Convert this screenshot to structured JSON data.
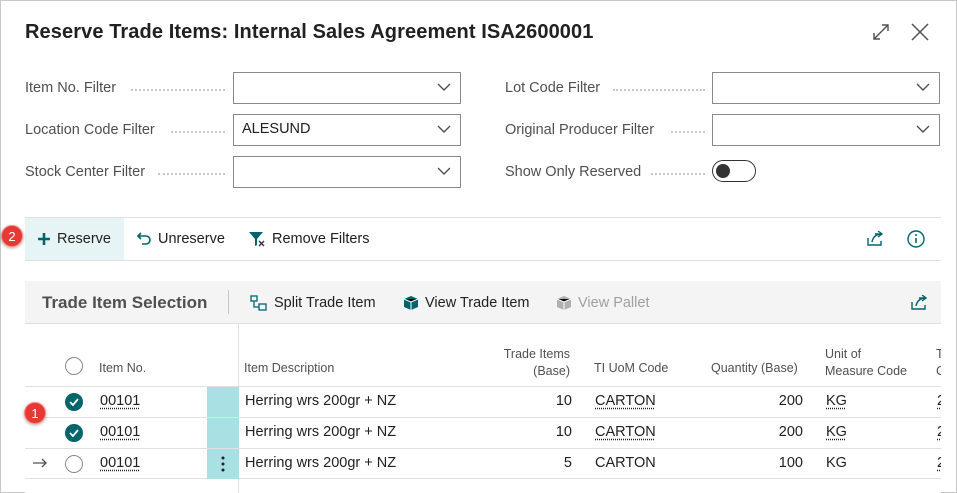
{
  "dialog": {
    "title": "Reserve Trade Items: Internal Sales Agreement ISA2600001",
    "expand_icon": "expand-icon",
    "close_icon": "close-icon"
  },
  "filters": {
    "item_no": {
      "label": "Item No. Filter",
      "value": ""
    },
    "location_code": {
      "label": "Location Code Filter",
      "value": "ALESUND"
    },
    "stock_center": {
      "label": "Stock Center Filter",
      "value": ""
    },
    "lot_code": {
      "label": "Lot Code Filter",
      "value": ""
    },
    "original_producer": {
      "label": "Original Producer Filter",
      "value": ""
    },
    "show_only_reserved": {
      "label": "Show Only Reserved",
      "value": false
    }
  },
  "actions": {
    "reserve": "Reserve",
    "unreserve": "Unreserve",
    "remove_filters": "Remove Filters",
    "share_icon": "share-icon",
    "info_icon": "info-icon"
  },
  "badges": {
    "one": "1",
    "two": "2"
  },
  "part": {
    "title": "Trade Item Selection",
    "actions": {
      "split": "Split Trade Item",
      "view_trade_item": "View Trade Item",
      "view_pallet": "View Pallet"
    },
    "columns": {
      "item_no": "Item No.",
      "item_description": "Item Description",
      "trade_items_l1": "Trade Items",
      "trade_items_l2": "(Base)",
      "ti_uom": "TI UoM Code",
      "quantity": "Quantity (Base)",
      "uom_l1": "Unit of",
      "uom_l2": "Measure Code",
      "next_l1": "T",
      "next_l2": "C"
    },
    "rows": [
      {
        "selected": true,
        "item_no": "00101",
        "description": "Herring wrs 200gr + NZ",
        "trade_items": "10",
        "ti_uom": "CARTON",
        "quantity": "200",
        "uom": "KG",
        "next": "2"
      },
      {
        "selected": true,
        "item_no": "00101",
        "description": "Herring wrs 200gr + NZ",
        "trade_items": "10",
        "ti_uom": "CARTON",
        "quantity": "200",
        "uom": "KG",
        "next": "2"
      },
      {
        "selected": false,
        "current": true,
        "item_no": "00101",
        "description": "Herring wrs 200gr + NZ",
        "trade_items": "5",
        "ti_uom": "CARTON",
        "quantity": "100",
        "uom": "KG",
        "next": "2"
      }
    ]
  },
  "colors": {
    "accent": "#00656b",
    "selection": "#a8e0e4",
    "active_action": "#e6f4f5",
    "badge": "#e53935"
  }
}
